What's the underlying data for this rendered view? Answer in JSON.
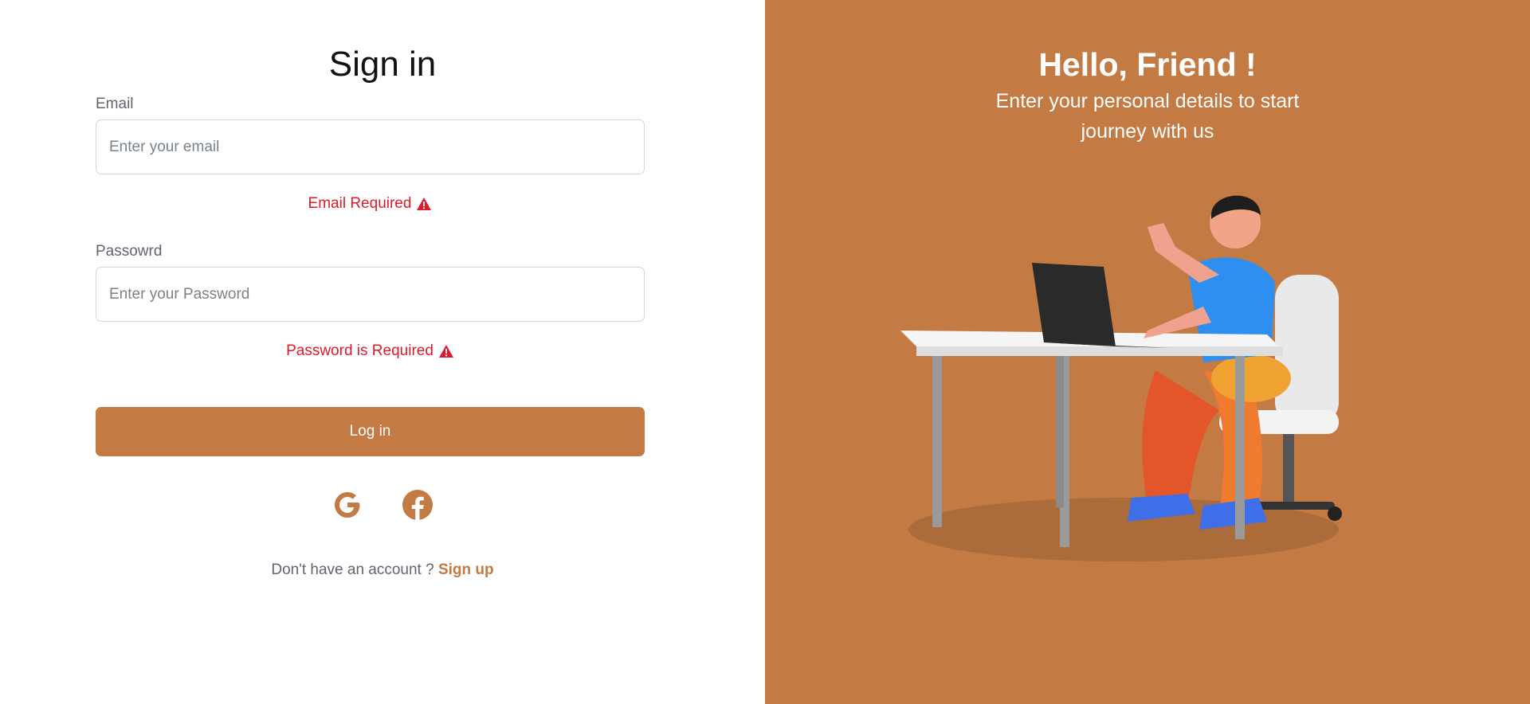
{
  "signin": {
    "title": "Sign in",
    "email_label": "Email",
    "email_placeholder": "Enter your email",
    "email_error": "Email Required",
    "password_label": "Passowrd",
    "password_placeholder": "Enter your Password",
    "password_error": "Password is Required",
    "login_label": "Log in",
    "signup_prompt": "Don't have an account ?",
    "signup_link": "Sign up"
  },
  "socials": [
    "google-icon",
    "facebook-icon"
  ],
  "welcome": {
    "title": "Hello, Friend !",
    "subtitle": "Enter your personal details to start journey with us"
  },
  "colors": {
    "accent": "#c37a43",
    "error": "#e0192b",
    "label": "#5f6670"
  }
}
